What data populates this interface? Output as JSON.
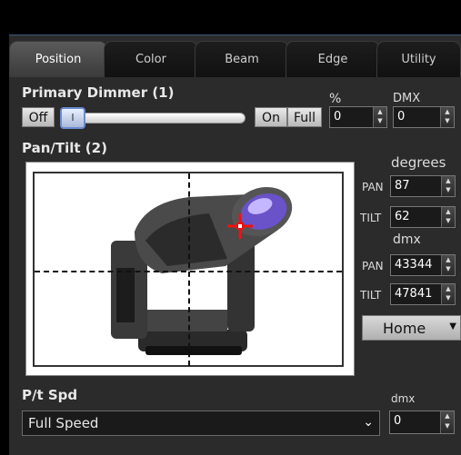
{
  "tabs": [
    {
      "label": "Position",
      "active": true
    },
    {
      "label": "Color",
      "active": false
    },
    {
      "label": "Beam",
      "active": false
    },
    {
      "label": "Edge",
      "active": false
    },
    {
      "label": "Utility",
      "active": false
    }
  ],
  "dimmer": {
    "title": "Primary Dimmer (1)",
    "off_label": "Off",
    "on_label": "On",
    "full_label": "Full",
    "percent_header": "%",
    "dmx_header": "DMX",
    "percent_value": "0",
    "dmx_value": "0",
    "slider_value": 0,
    "handle_glyph": "I"
  },
  "pantilt": {
    "title": "Pan/Tilt (2)",
    "degrees_header": "degrees",
    "dmx_header": "dmx",
    "pan_label": "PAN",
    "tilt_label": "TILT",
    "pan_degrees": "87",
    "tilt_degrees": "62",
    "pan_dmx": "43344",
    "tilt_dmx": "47841",
    "home_label": "Home"
  },
  "speed": {
    "title": "P/t Spd",
    "value": "Full Speed",
    "dmx_header": "dmx",
    "dmx_value": "0"
  },
  "colors": {
    "accent": "#e11",
    "frame": "#2b2b2b",
    "lens": "#6a52c8"
  }
}
